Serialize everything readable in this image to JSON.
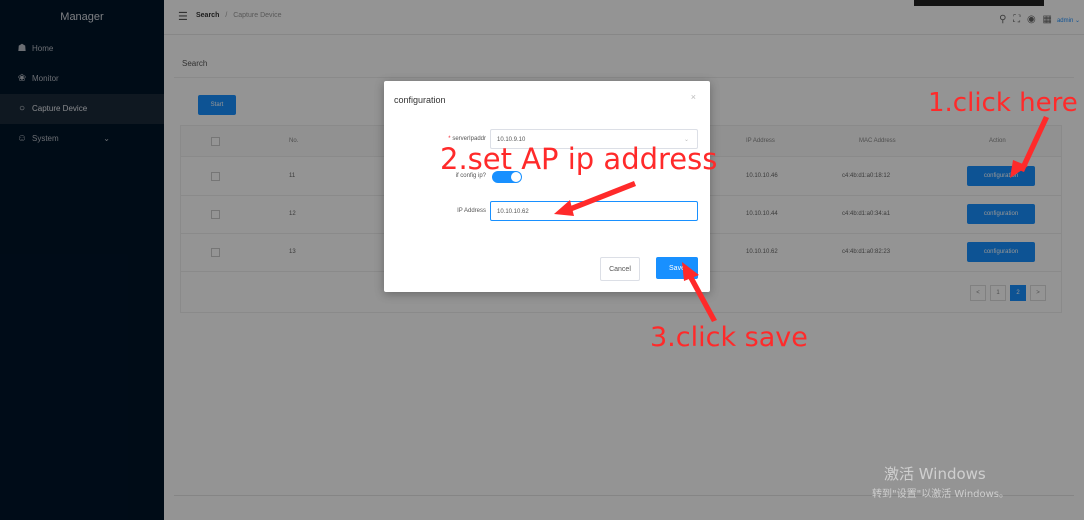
{
  "sidebar": {
    "title": "Manager",
    "items": [
      {
        "label": "Home",
        "icon": "home-icon"
      },
      {
        "label": "Monitor",
        "icon": "monitor-icon"
      },
      {
        "label": "Capture Device",
        "icon": "search-icon",
        "active": true
      },
      {
        "label": "System",
        "icon": "user-icon",
        "chevron": true
      }
    ]
  },
  "header": {
    "breadcrumb_current": "Search",
    "breadcrumb_separator": "/",
    "breadcrumb_page": "Capture Device",
    "user": "admin"
  },
  "main": {
    "page_title": "Search",
    "start_label": "Start",
    "columns": {
      "no": "No.",
      "ip": "IP Address",
      "mac": "MAC Address",
      "action": "Action"
    },
    "rows": [
      {
        "no": "11",
        "ip": "10.10.10.46",
        "mac": "c4:4b:d1:a0:18:12",
        "action": "configuration"
      },
      {
        "no": "12",
        "ip": "10.10.10.44",
        "mac": "c4:4b:d1:a0:34:a1",
        "action": "configuration"
      },
      {
        "no": "13",
        "ip": "10.10.10.62",
        "mac": "c4:4b:d1:a0:82:23",
        "action": "configuration"
      }
    ],
    "pager": {
      "prev": "<",
      "pages": [
        "1",
        "2"
      ],
      "current_page": "2",
      "next": ">"
    }
  },
  "modal": {
    "title": "configuration",
    "close": "×",
    "server_label": "serverIpaddr",
    "server_value": "10.10.9.10",
    "config_label": "if config ip?",
    "config_on": true,
    "ip_label": "IP Address",
    "ip_value": "10.10.10.62",
    "cancel": "Cancel",
    "save": "Save"
  },
  "annotations": {
    "step1": "1.click here",
    "step2": "2.set AP ip address",
    "step3": "3.click save",
    "color": "#ff2a2a"
  },
  "watermark": {
    "line1": "激活 Windows",
    "line2": "转到\"设置\"以激活 Windows。"
  }
}
